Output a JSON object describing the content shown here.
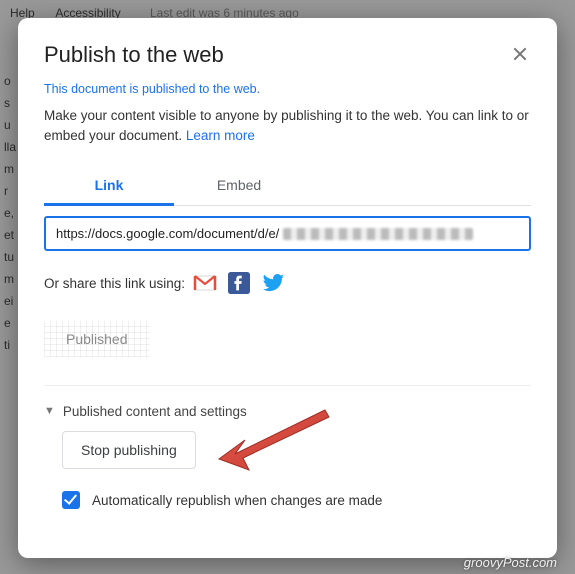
{
  "background": {
    "menu_help": "Help",
    "menu_accessibility": "Accessibility",
    "last_edit": "Last edit was 6 minutes ago",
    "lorem_fragments": "o su lla m re, et tu m ei e ti"
  },
  "dialog": {
    "title": "Publish to the web",
    "status_line": "This document is published to the web.",
    "description_prefix": "Make your content visible to anyone by publishing it to the web. You can link to or embed your document. ",
    "learn_more": "Learn more",
    "tabs": {
      "link": "Link",
      "embed": "Embed"
    },
    "url_prefix": "https://docs.google.com/document/d/e/",
    "share_label": "Or share this link using:",
    "icons": {
      "gmail": "gmail-icon",
      "facebook": "facebook-icon",
      "twitter": "twitter-icon"
    },
    "published_state": "Published",
    "collapse_label": "Published content and settings",
    "stop_button": "Stop publishing",
    "auto_republish": "Automatically republish when changes are made",
    "auto_republish_checked": true
  },
  "watermark": "groovyPost.com",
  "annotation": {
    "arrow_color": "#d84a3f",
    "arrow_points_to": "stop-publishing-button"
  }
}
